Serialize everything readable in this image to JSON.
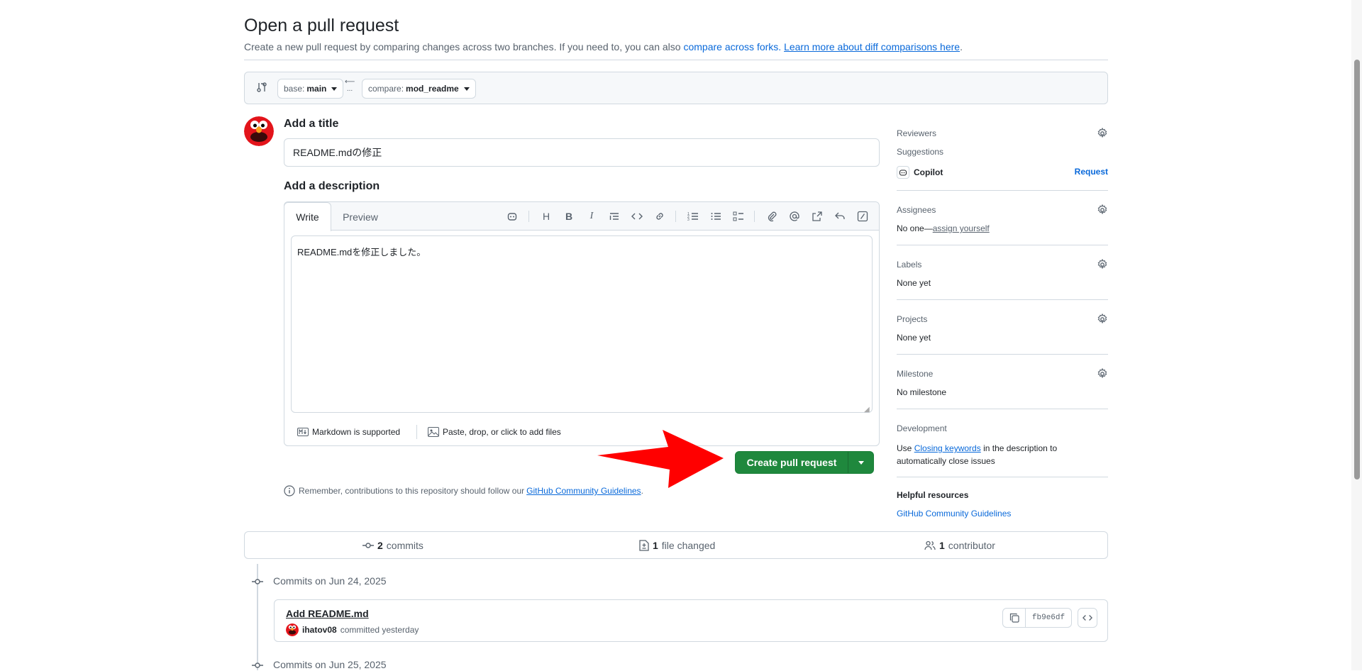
{
  "header": {
    "title": "Open a pull request",
    "subtitle_text": "Create a new pull request by comparing changes across two branches. If you need to, you can also",
    "compare_forks_link": "compare across forks.",
    "learn_more_link": "Learn more about diff comparisons here",
    "subtitle_end": "."
  },
  "range": {
    "base_prefix": "base:",
    "base_branch": "main",
    "compare_prefix": "compare:",
    "compare_branch": "mod_readme",
    "arrow_dots": "..."
  },
  "form": {
    "title_label": "Add a title",
    "title_value": "README.mdの修正",
    "description_label": "Add a description",
    "tabs": [
      "Write",
      "Preview"
    ],
    "description_value": "README.mdを修正しました。",
    "markdown_note": "Markdown is supported",
    "attach_note": "Paste, drop, or click to add files",
    "toolbar_icons": [
      "copilot-icon",
      "heading-icon",
      "bold-icon",
      "italic-icon",
      "quote-icon",
      "code-icon",
      "link-icon",
      "ordered-list-icon",
      "unordered-list-icon",
      "task-list-icon",
      "attach-icon",
      "mention-icon",
      "reference-icon",
      "undo-icon",
      "slash-commands-icon"
    ]
  },
  "create_button": {
    "label": "Create pull request",
    "color": "#1f883d"
  },
  "reminder": {
    "text": "Remember, contributions to this repository should follow our",
    "link": "GitHub Community Guidelines",
    "end": "."
  },
  "sidebar": {
    "reviewers": {
      "title": "Reviewers",
      "suggestions_label": "Suggestions",
      "suggested_user": "Copilot",
      "request_label": "Request"
    },
    "assignees": {
      "title": "Assignees",
      "value_prefix": "No one—",
      "value_link": "assign yourself"
    },
    "labels": {
      "title": "Labels",
      "value": "None yet"
    },
    "projects": {
      "title": "Projects",
      "value": "None yet"
    },
    "milestone": {
      "title": "Milestone",
      "value": "No milestone"
    },
    "development": {
      "title": "Development",
      "text_prefix": "Use",
      "link": "Closing keywords",
      "text_suffix": "in the description to",
      "text_line2": "automatically close issues"
    },
    "helpful": {
      "title": "Helpful resources",
      "link": "GitHub Community Guidelines"
    }
  },
  "summary": {
    "commits_count": "2",
    "commits_label": "commits",
    "files_count": "1",
    "files_label": "file changed",
    "contributors_count": "1",
    "contributors_label": "contributor"
  },
  "timeline": {
    "groups": [
      {
        "label": "Commits on Jun 24, 2025"
      },
      {
        "label": "Commits on Jun 25, 2025"
      }
    ],
    "commit": {
      "message": "Add README.md",
      "author": "ihatov08",
      "action": "committed yesterday",
      "sha": "fb9e6df"
    }
  },
  "colors": {
    "link": "#0969da",
    "border": "#d1d9e0",
    "muted": "#59636e",
    "green": "#1f883d",
    "annotation_arrow": "#ff0000"
  }
}
